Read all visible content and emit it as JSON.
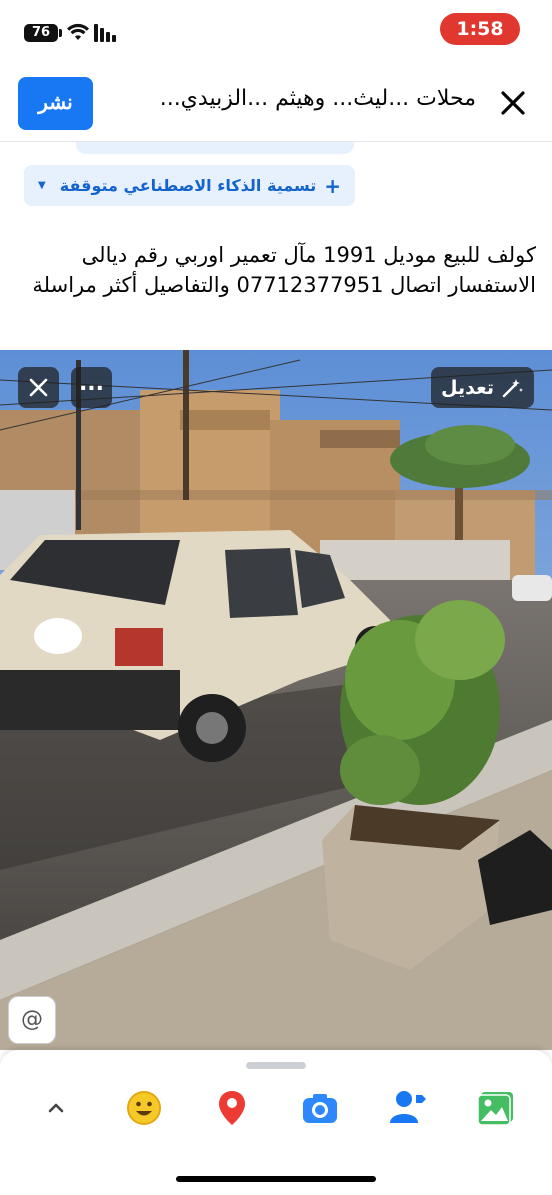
{
  "status_bar": {
    "battery": "76",
    "time": "1:58"
  },
  "header": {
    "publish_label": "نشر",
    "title": "محلات ...ليث... وهيثم ...الزبيدي..."
  },
  "ai_chip": {
    "label": "تسمية الذكاء الاصطناعي متوقفة"
  },
  "post": {
    "text": "كولف للبيع موديل 1991 مآل تعمير اوربي رقم ديالى الاستفسار اتصال 07712377951 والتفاصيل أكثر مراسلة"
  },
  "photo": {
    "edit_label": "تعديل",
    "more_label": "..."
  },
  "toolbar": {
    "items": [
      "chevron-up-icon",
      "emoji-icon",
      "location-pin-icon",
      "camera-icon",
      "tag-people-icon",
      "photo-gallery-icon"
    ]
  },
  "colors": {
    "accent": "#1877f2",
    "time_pill": "#e0382f",
    "chip_bg": "#e7f0fd"
  }
}
